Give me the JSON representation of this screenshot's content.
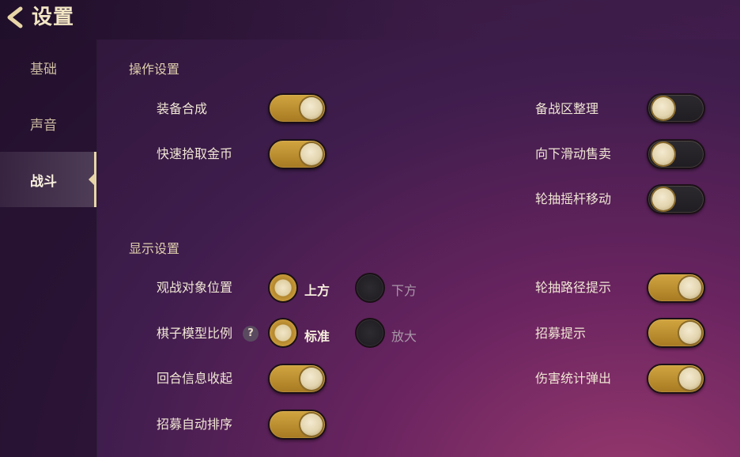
{
  "header": {
    "title": "设置",
    "back_icon": "chevron-left-icon"
  },
  "sidebar": {
    "items": [
      {
        "label": "基础",
        "active": false
      },
      {
        "label": "声音",
        "active": false
      },
      {
        "label": "战斗",
        "active": true
      }
    ]
  },
  "sections": {
    "operation": {
      "title": "操作设置",
      "left": [
        {
          "label": "装备合成",
          "on": true
        },
        {
          "label": "快速拾取金币",
          "on": true
        }
      ],
      "right": [
        {
          "label": "备战区整理",
          "on": false
        },
        {
          "label": "向下滑动售卖",
          "on": false
        },
        {
          "label": "轮抽摇杆移动",
          "on": false
        }
      ]
    },
    "display": {
      "title": "显示设置",
      "spectate": {
        "label": "观战对象位置",
        "option_a": "上方",
        "option_b": "下方",
        "selected": "上方"
      },
      "scale": {
        "label": "棋子模型比例",
        "help": "?",
        "option_a": "标准",
        "option_b": "放大",
        "selected": "标准"
      },
      "left": [
        {
          "label": "回合信息收起",
          "on": true
        },
        {
          "label": "招募自动排序",
          "on": true
        }
      ],
      "right": [
        {
          "label": "轮抽路径提示",
          "on": true
        },
        {
          "label": "招募提示",
          "on": true
        },
        {
          "label": "伤害统计弹出",
          "on": true
        }
      ]
    }
  },
  "colors": {
    "toggle_on": "#c99a38",
    "toggle_off": "#262428",
    "knob": "#e8dcb8",
    "accent": "#e8d6a8"
  }
}
